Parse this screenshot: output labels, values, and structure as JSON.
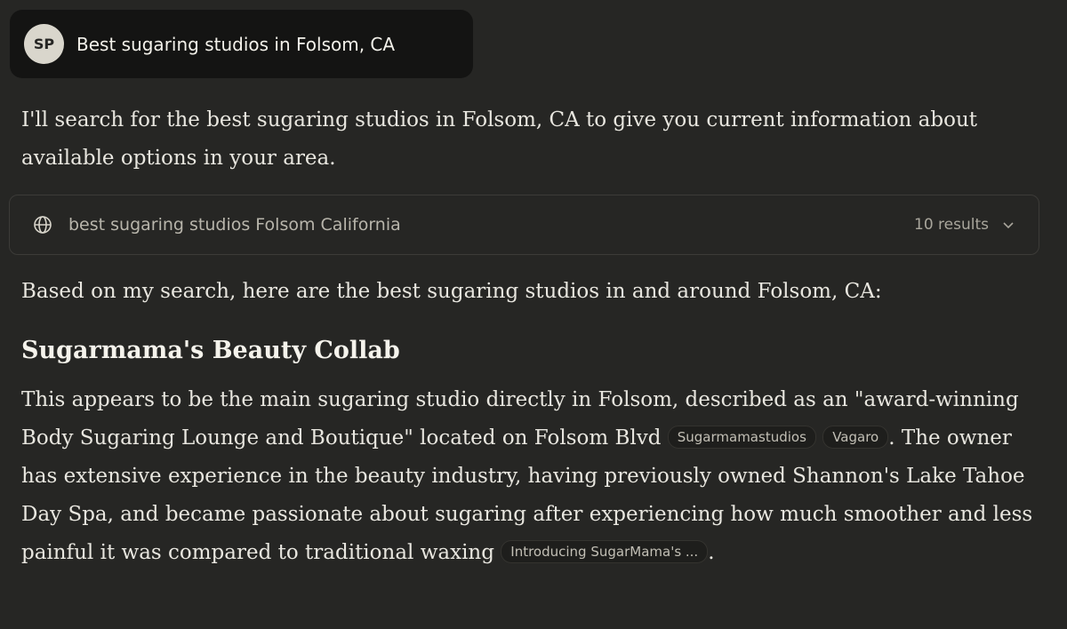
{
  "user_message": {
    "avatar_initials": "SP",
    "text": "Best sugaring studios in Folsom, CA"
  },
  "response": {
    "intro": "I'll search for the best sugaring studios in Folsom, CA to give you current information about available options in your area.",
    "search_tool": {
      "icon": "globe-icon",
      "query": "best sugaring studios Folsom California",
      "results_count": "10 results",
      "expand_icon": "chevron-down-icon"
    },
    "lead_in": "Based on my search, here are the best sugaring studios in and around Folsom, CA:",
    "heading": "Sugarmama's Beauty Collab",
    "body": {
      "part1": "This appears to be the main sugaring studio directly in Folsom, described as an \"award-winning Body Sugaring Lounge and Boutique\" located on Folsom Blvd ",
      "citation1": "Sugarmamastudios",
      "citation2": "Vagaro",
      "part2": ". The owner has extensive experience in the beauty industry, having previously owned Shannon's Lake Tahoe Day Spa, and became passionate about sugaring after experiencing how much smoother and less painful it was compared to traditional waxing ",
      "citation3": "Introducing SugarMama's ...",
      "part3": "."
    }
  },
  "colors": {
    "background": "#262624",
    "user_bubble": "#141413",
    "text": "#e8e6df"
  }
}
